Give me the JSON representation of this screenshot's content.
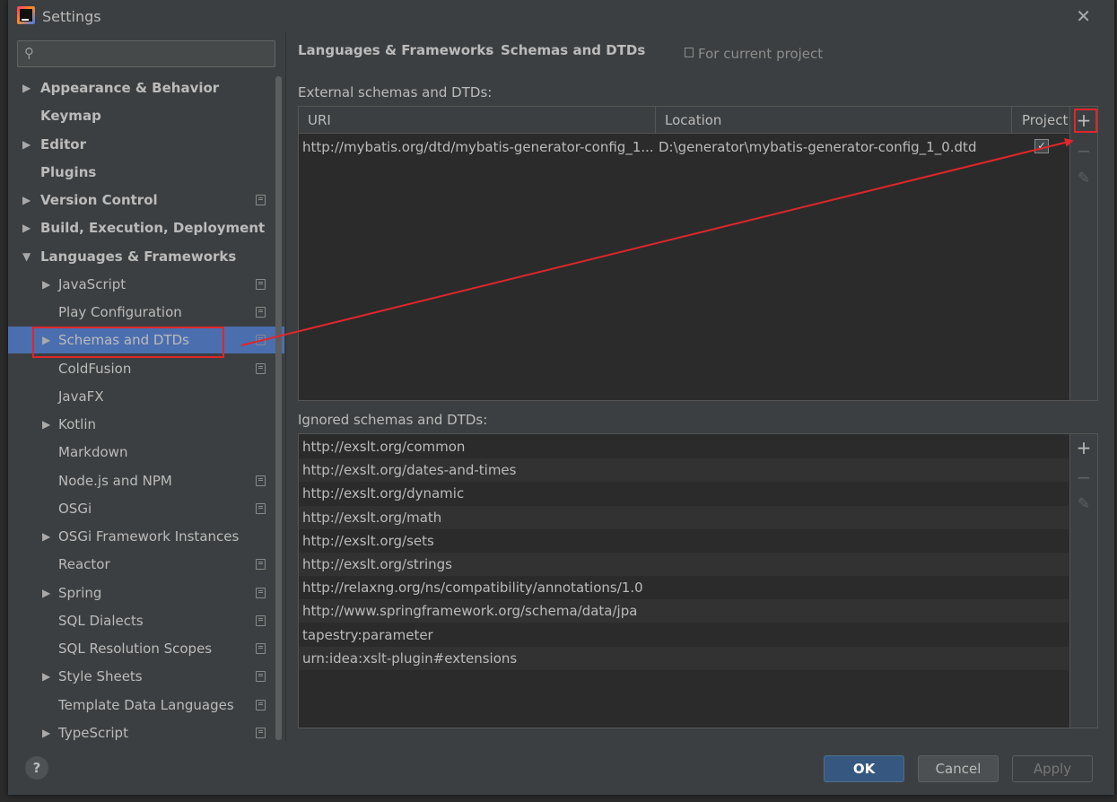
{
  "window": {
    "title": "Settings",
    "close_glyph": "✕"
  },
  "search": {
    "placeholder": ""
  },
  "tree": [
    {
      "label": "Appearance & Behavior",
      "bold": true,
      "arrow": "right",
      "indent": 0,
      "project": false
    },
    {
      "label": "Keymap",
      "bold": true,
      "arrow": "",
      "indent": 0,
      "project": false
    },
    {
      "label": "Editor",
      "bold": true,
      "arrow": "right",
      "indent": 0,
      "project": false
    },
    {
      "label": "Plugins",
      "bold": true,
      "arrow": "",
      "indent": 0,
      "project": false
    },
    {
      "label": "Version Control",
      "bold": true,
      "arrow": "right",
      "indent": 0,
      "project": true
    },
    {
      "label": "Build, Execution, Deployment",
      "bold": true,
      "arrow": "right",
      "indent": 0,
      "project": false
    },
    {
      "label": "Languages & Frameworks",
      "bold": true,
      "arrow": "down",
      "indent": 0,
      "project": false
    },
    {
      "label": "JavaScript",
      "bold": false,
      "arrow": "right",
      "indent": 1,
      "project": true
    },
    {
      "label": "Play Configuration",
      "bold": false,
      "arrow": "",
      "indent": 1,
      "project": true
    },
    {
      "label": "Schemas and DTDs",
      "bold": false,
      "arrow": "right",
      "indent": 1,
      "project": true,
      "selected": true
    },
    {
      "label": "ColdFusion",
      "bold": false,
      "arrow": "",
      "indent": 1,
      "project": true
    },
    {
      "label": "JavaFX",
      "bold": false,
      "arrow": "",
      "indent": 1,
      "project": false
    },
    {
      "label": "Kotlin",
      "bold": false,
      "arrow": "right",
      "indent": 1,
      "project": false
    },
    {
      "label": "Markdown",
      "bold": false,
      "arrow": "",
      "indent": 1,
      "project": false
    },
    {
      "label": "Node.js and NPM",
      "bold": false,
      "arrow": "",
      "indent": 1,
      "project": true
    },
    {
      "label": "OSGi",
      "bold": false,
      "arrow": "",
      "indent": 1,
      "project": true
    },
    {
      "label": "OSGi Framework Instances",
      "bold": false,
      "arrow": "right",
      "indent": 1,
      "project": false
    },
    {
      "label": "Reactor",
      "bold": false,
      "arrow": "",
      "indent": 1,
      "project": true
    },
    {
      "label": "Spring",
      "bold": false,
      "arrow": "right",
      "indent": 1,
      "project": true
    },
    {
      "label": "SQL Dialects",
      "bold": false,
      "arrow": "",
      "indent": 1,
      "project": true
    },
    {
      "label": "SQL Resolution Scopes",
      "bold": false,
      "arrow": "",
      "indent": 1,
      "project": true
    },
    {
      "label": "Style Sheets",
      "bold": false,
      "arrow": "right",
      "indent": 1,
      "project": true
    },
    {
      "label": "Template Data Languages",
      "bold": false,
      "arrow": "",
      "indent": 1,
      "project": true
    },
    {
      "label": "TypeScript",
      "bold": false,
      "arrow": "right",
      "indent": 1,
      "project": true
    }
  ],
  "breadcrumb": {
    "parent": "Languages & Frameworks",
    "separator": "›",
    "current": "Schemas and DTDs",
    "scope": "For current project"
  },
  "external": {
    "label": "External schemas and DTDs:",
    "columns": {
      "uri": "URI",
      "location": "Location",
      "project": "Project"
    },
    "row": {
      "uri": "http://mybatis.org/dtd/mybatis-generator-config_1...",
      "location": "D:\\generator\\mybatis-generator-config_1_0.dtd",
      "project_checked": "✓"
    },
    "tools": {
      "add": "+",
      "remove": "−",
      "edit": "✎"
    }
  },
  "ignored": {
    "label": "Ignored schemas and DTDs:",
    "items": [
      "http://exslt.org/common",
      "http://exslt.org/dates-and-times",
      "http://exslt.org/dynamic",
      "http://exslt.org/math",
      "http://exslt.org/sets",
      "http://exslt.org/strings",
      "http://relaxng.org/ns/compatibility/annotations/1.0",
      "http://www.springframework.org/schema/data/jpa",
      "tapestry:parameter",
      "urn:idea:xslt-plugin#extensions"
    ],
    "tools": {
      "add": "+",
      "remove": "−",
      "edit": "✎"
    }
  },
  "footer": {
    "help": "?",
    "ok": "OK",
    "cancel": "Cancel",
    "apply": "Apply"
  },
  "colors": {
    "selection": "#4b6eaf",
    "annotation": "#e0262b",
    "ok_button": "#365880"
  }
}
